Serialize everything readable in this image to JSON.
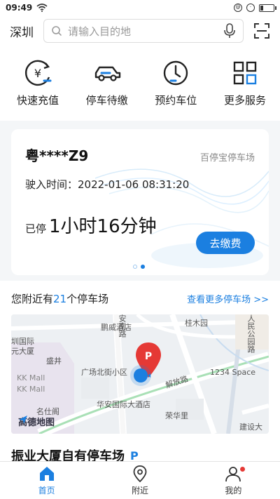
{
  "status_bar": {
    "time": "09:49"
  },
  "search": {
    "city": "深圳",
    "placeholder": "请输入目的地"
  },
  "services": [
    {
      "label": "快速充值",
      "icon": "yuan-recharge-icon"
    },
    {
      "label": "停车待缴",
      "icon": "car-icon"
    },
    {
      "label": "预约车位",
      "icon": "clock-icon"
    },
    {
      "label": "更多服务",
      "icon": "grid-icon"
    }
  ],
  "parking_card": {
    "plate": "粤****Z9",
    "lot_name": "百停宝停车场",
    "enter_time": "驶入时间：2022-01-06 08:31:20",
    "duration_prefix": "已停",
    "duration_value": "1小时16分钟",
    "pay_button": "去缴费",
    "pager": {
      "count": 2,
      "active": 2
    }
  },
  "nearby": {
    "prefix": "您附近有",
    "count": "21",
    "suffix": "个停车场",
    "more_link": "查看更多停车场 >>"
  },
  "map": {
    "labels": [
      "鹏威酒店",
      "安南路",
      "桂木园",
      "人民公园路",
      "圳国际",
      "元大厦",
      "盛井",
      "广场北街小区",
      "KK Mall",
      "KK Mall",
      "解放路",
      "1234 Space",
      "华安国际大酒店",
      "荣华里",
      "建设大",
      "名仕阁"
    ],
    "logo": "高德地图"
  },
  "lot_title": "振业大厦自有停车场",
  "tabbar": [
    {
      "label": "首页",
      "icon": "home-icon",
      "active": true
    },
    {
      "label": "附近",
      "icon": "location-pin-icon",
      "active": false
    },
    {
      "label": "我的",
      "icon": "user-icon",
      "active": false
    }
  ],
  "colors": {
    "accent": "#1b7fe0",
    "notification": "#e53935"
  }
}
